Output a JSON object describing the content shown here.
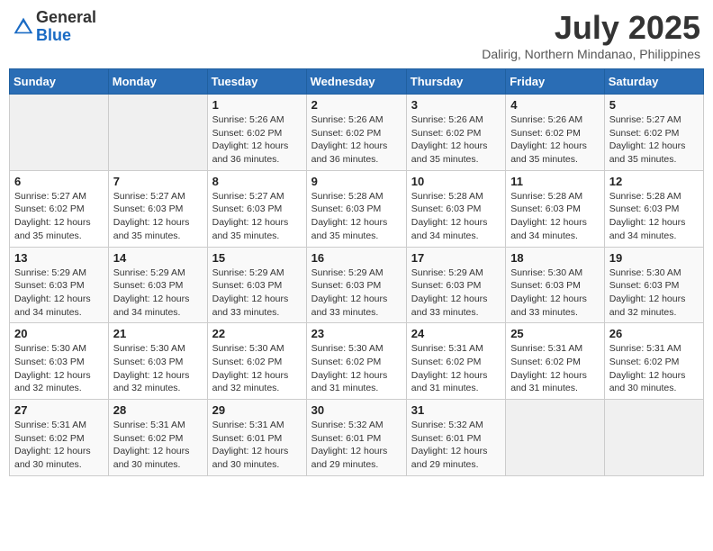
{
  "header": {
    "logo_general": "General",
    "logo_blue": "Blue",
    "month_title": "July 2025",
    "subtitle": "Dalirig, Northern Mindanao, Philippines"
  },
  "weekdays": [
    "Sunday",
    "Monday",
    "Tuesday",
    "Wednesday",
    "Thursday",
    "Friday",
    "Saturday"
  ],
  "weeks": [
    [
      {
        "day": "",
        "info": ""
      },
      {
        "day": "",
        "info": ""
      },
      {
        "day": "1",
        "info": "Sunrise: 5:26 AM\nSunset: 6:02 PM\nDaylight: 12 hours and 36 minutes."
      },
      {
        "day": "2",
        "info": "Sunrise: 5:26 AM\nSunset: 6:02 PM\nDaylight: 12 hours and 36 minutes."
      },
      {
        "day": "3",
        "info": "Sunrise: 5:26 AM\nSunset: 6:02 PM\nDaylight: 12 hours and 35 minutes."
      },
      {
        "day": "4",
        "info": "Sunrise: 5:26 AM\nSunset: 6:02 PM\nDaylight: 12 hours and 35 minutes."
      },
      {
        "day": "5",
        "info": "Sunrise: 5:27 AM\nSunset: 6:02 PM\nDaylight: 12 hours and 35 minutes."
      }
    ],
    [
      {
        "day": "6",
        "info": "Sunrise: 5:27 AM\nSunset: 6:02 PM\nDaylight: 12 hours and 35 minutes."
      },
      {
        "day": "7",
        "info": "Sunrise: 5:27 AM\nSunset: 6:03 PM\nDaylight: 12 hours and 35 minutes."
      },
      {
        "day": "8",
        "info": "Sunrise: 5:27 AM\nSunset: 6:03 PM\nDaylight: 12 hours and 35 minutes."
      },
      {
        "day": "9",
        "info": "Sunrise: 5:28 AM\nSunset: 6:03 PM\nDaylight: 12 hours and 35 minutes."
      },
      {
        "day": "10",
        "info": "Sunrise: 5:28 AM\nSunset: 6:03 PM\nDaylight: 12 hours and 34 minutes."
      },
      {
        "day": "11",
        "info": "Sunrise: 5:28 AM\nSunset: 6:03 PM\nDaylight: 12 hours and 34 minutes."
      },
      {
        "day": "12",
        "info": "Sunrise: 5:28 AM\nSunset: 6:03 PM\nDaylight: 12 hours and 34 minutes."
      }
    ],
    [
      {
        "day": "13",
        "info": "Sunrise: 5:29 AM\nSunset: 6:03 PM\nDaylight: 12 hours and 34 minutes."
      },
      {
        "day": "14",
        "info": "Sunrise: 5:29 AM\nSunset: 6:03 PM\nDaylight: 12 hours and 34 minutes."
      },
      {
        "day": "15",
        "info": "Sunrise: 5:29 AM\nSunset: 6:03 PM\nDaylight: 12 hours and 33 minutes."
      },
      {
        "day": "16",
        "info": "Sunrise: 5:29 AM\nSunset: 6:03 PM\nDaylight: 12 hours and 33 minutes."
      },
      {
        "day": "17",
        "info": "Sunrise: 5:29 AM\nSunset: 6:03 PM\nDaylight: 12 hours and 33 minutes."
      },
      {
        "day": "18",
        "info": "Sunrise: 5:30 AM\nSunset: 6:03 PM\nDaylight: 12 hours and 33 minutes."
      },
      {
        "day": "19",
        "info": "Sunrise: 5:30 AM\nSunset: 6:03 PM\nDaylight: 12 hours and 32 minutes."
      }
    ],
    [
      {
        "day": "20",
        "info": "Sunrise: 5:30 AM\nSunset: 6:03 PM\nDaylight: 12 hours and 32 minutes."
      },
      {
        "day": "21",
        "info": "Sunrise: 5:30 AM\nSunset: 6:03 PM\nDaylight: 12 hours and 32 minutes."
      },
      {
        "day": "22",
        "info": "Sunrise: 5:30 AM\nSunset: 6:02 PM\nDaylight: 12 hours and 32 minutes."
      },
      {
        "day": "23",
        "info": "Sunrise: 5:30 AM\nSunset: 6:02 PM\nDaylight: 12 hours and 31 minutes."
      },
      {
        "day": "24",
        "info": "Sunrise: 5:31 AM\nSunset: 6:02 PM\nDaylight: 12 hours and 31 minutes."
      },
      {
        "day": "25",
        "info": "Sunrise: 5:31 AM\nSunset: 6:02 PM\nDaylight: 12 hours and 31 minutes."
      },
      {
        "day": "26",
        "info": "Sunrise: 5:31 AM\nSunset: 6:02 PM\nDaylight: 12 hours and 30 minutes."
      }
    ],
    [
      {
        "day": "27",
        "info": "Sunrise: 5:31 AM\nSunset: 6:02 PM\nDaylight: 12 hours and 30 minutes."
      },
      {
        "day": "28",
        "info": "Sunrise: 5:31 AM\nSunset: 6:02 PM\nDaylight: 12 hours and 30 minutes."
      },
      {
        "day": "29",
        "info": "Sunrise: 5:31 AM\nSunset: 6:01 PM\nDaylight: 12 hours and 30 minutes."
      },
      {
        "day": "30",
        "info": "Sunrise: 5:32 AM\nSunset: 6:01 PM\nDaylight: 12 hours and 29 minutes."
      },
      {
        "day": "31",
        "info": "Sunrise: 5:32 AM\nSunset: 6:01 PM\nDaylight: 12 hours and 29 minutes."
      },
      {
        "day": "",
        "info": ""
      },
      {
        "day": "",
        "info": ""
      }
    ]
  ]
}
